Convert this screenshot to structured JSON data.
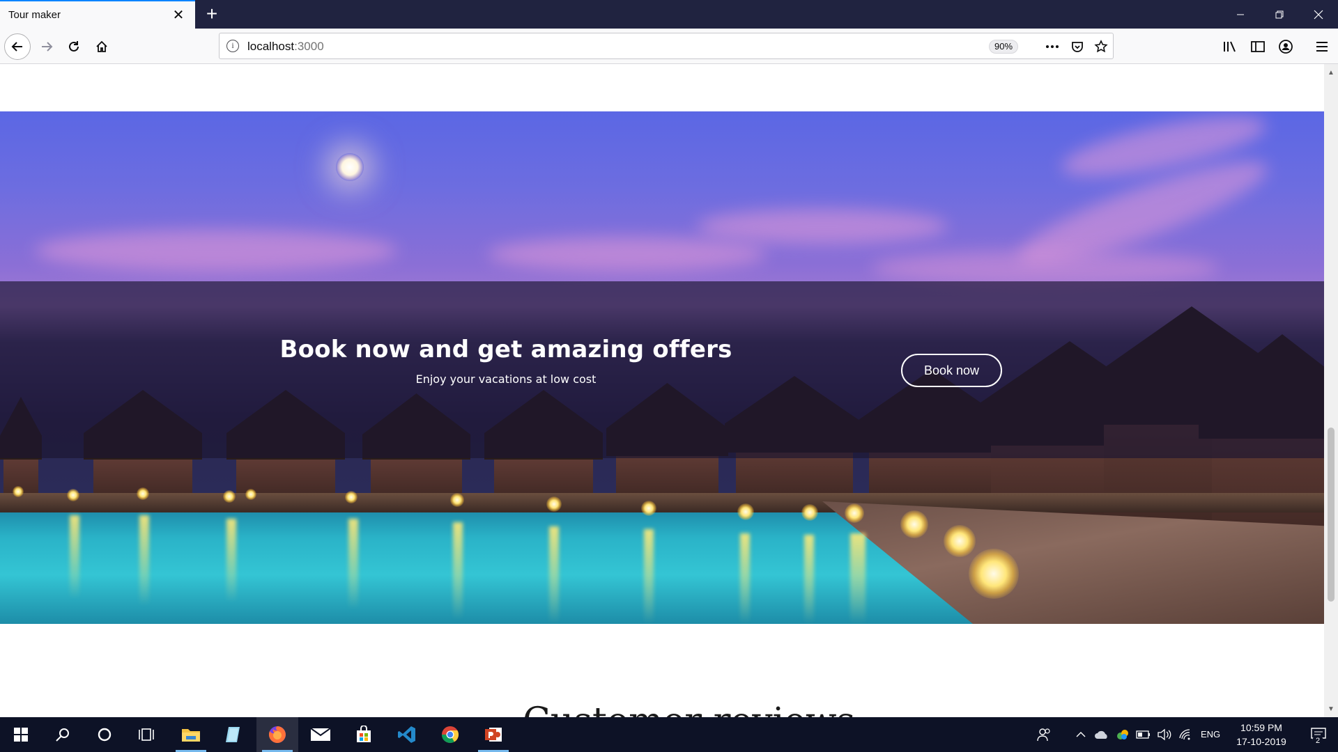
{
  "browser": {
    "tab_title": "Tour maker",
    "tab_close": "✕",
    "new_tab": "+",
    "url_host": "localhost",
    "url_port": ":3000",
    "zoom": "90%",
    "url_info_glyph": "i"
  },
  "page": {
    "hero": {
      "title": "Book now and get amazing offers",
      "subtitle": "Enjoy your vacations at low cost",
      "button_label": "Book now"
    },
    "next_section_heading": "Customer reviews"
  },
  "taskbar": {
    "items": [
      "start-icon",
      "search-icon",
      "cortana-icon",
      "task-view-icon",
      "file-explorer-icon",
      "notepad-icon",
      "firefox-icon",
      "mail-icon",
      "store-icon",
      "vscode-icon",
      "chrome-icon",
      "powerpoint-icon"
    ],
    "language": "ENG",
    "time": "10:59 PM",
    "date": "17-10-2019",
    "notification_count": "2"
  },
  "colors": {
    "tabbar_bg": "#202340",
    "accent": "#0a84ff",
    "taskbar_bg": "#0d1226",
    "overlay": "rgba(28,22,48,0.66)"
  }
}
